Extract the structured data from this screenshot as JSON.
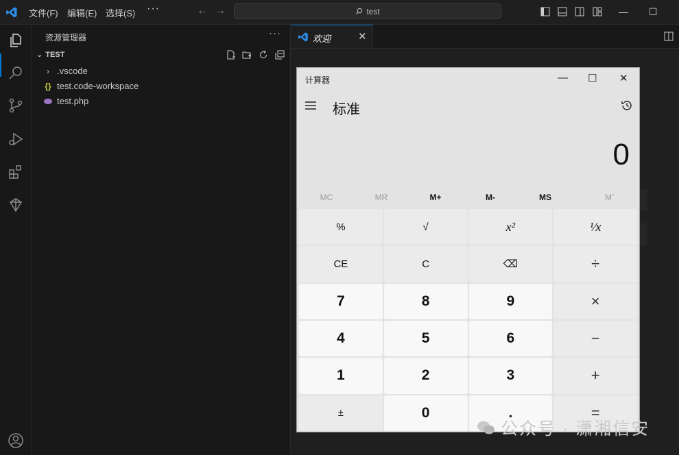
{
  "titlebar": {
    "menus": [
      "文件(F)",
      "编辑(E)",
      "选择(S)"
    ],
    "more": "···",
    "search": "test"
  },
  "sidebar": {
    "title": "资源管理器",
    "more": "···",
    "folder": "TEST",
    "items": [
      {
        "label": ".vscode",
        "icon": "chevron-right-icon"
      },
      {
        "label": "test.code-workspace",
        "icon": "json-braces-icon"
      },
      {
        "label": "test.php",
        "icon": "php-elephant-icon"
      }
    ]
  },
  "editor": {
    "tab_label": "欢迎",
    "tab_close": "✕"
  },
  "calculator": {
    "title": "计算器",
    "mode": "标准",
    "display": "0",
    "memory": [
      "MC",
      "MR",
      "M+",
      "M-",
      "MS",
      "Mˇ"
    ],
    "keys": [
      "%",
      "√",
      "x²",
      "¹⁄x",
      "CE",
      "C",
      "⌫",
      "÷",
      "7",
      "8",
      "9",
      "×",
      "4",
      "5",
      "6",
      "−",
      "1",
      "2",
      "3",
      "+",
      "±",
      "0",
      ".",
      "="
    ]
  },
  "watermark": "公众号 · 潇湘信安",
  "colors": {
    "accent": "#0078d4",
    "background": "#1f1f1f"
  }
}
